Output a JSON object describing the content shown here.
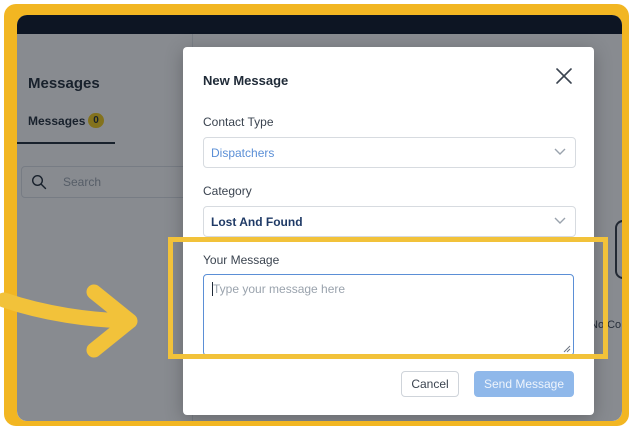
{
  "colors": {
    "frame": "#f2b622",
    "highlight": "#f2c23a",
    "topbar": "#0d1523",
    "badge": "#f5cc18",
    "textarea_focus": "#5b8fd6",
    "send_button": "#8fb8ea"
  },
  "left_panel": {
    "title": "Messages",
    "tab_label": "Messages",
    "tab_badge": "0",
    "search_placeholder": "Search"
  },
  "right_panel": {
    "partial_text": "No Co"
  },
  "modal": {
    "title": "New Message",
    "close_icon": "close-icon",
    "contact_type_label": "Contact Type",
    "contact_type_value": "Dispatchers",
    "category_label": "Category",
    "category_value": "Lost And Found",
    "message_label": "Your Message",
    "message_placeholder": "Type your message here",
    "cancel_label": "Cancel",
    "send_label": "Send Message"
  },
  "annotation": {
    "arrow_icon": "arrow-right-icon"
  }
}
